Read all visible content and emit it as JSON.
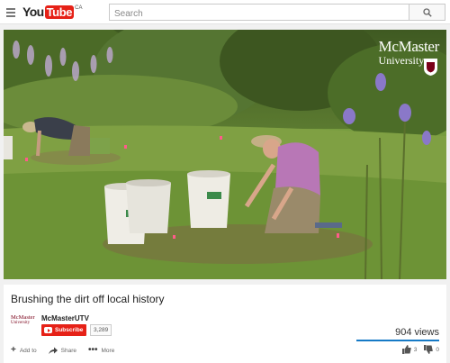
{
  "header": {
    "logo_you": "You",
    "logo_tube": "Tube",
    "logo_country": "CA",
    "search_placeholder": "Search"
  },
  "video": {
    "watermark_line1": "McMaster",
    "watermark_line2": "University"
  },
  "info": {
    "title": "Brushing the dirt off local history",
    "channel_name": "McMasterUTV",
    "channel_logo_line1": "McMaster",
    "channel_logo_line2": "University",
    "subscribe_label": "Subscribe",
    "subscriber_count": "3,289",
    "views": "904 views",
    "like_ratio": 1.0,
    "actions": {
      "add_to": "Add to",
      "share": "Share",
      "more": "More"
    },
    "likes": "3",
    "dislikes": "0"
  },
  "colors": {
    "brand_red": "#e62117",
    "like_bar_blue": "#167ac6",
    "mcmaster_maroon": "#7a0019"
  }
}
